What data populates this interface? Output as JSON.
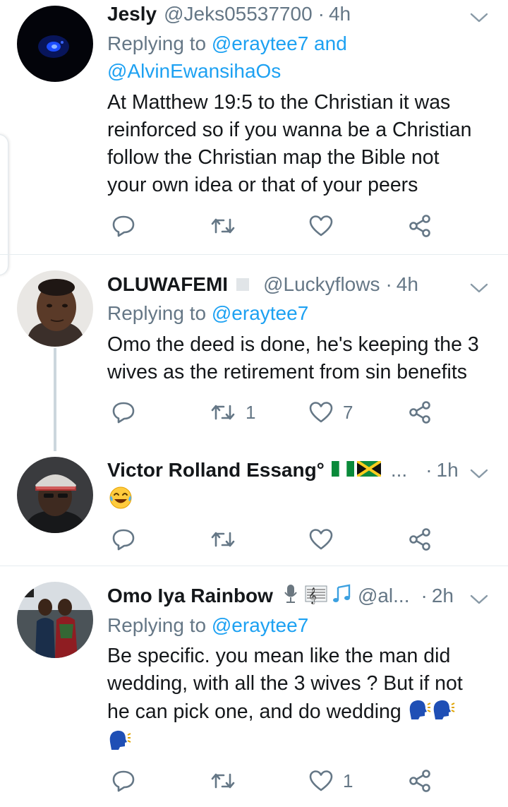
{
  "tweets": [
    {
      "name": "Jesly",
      "handle": "@Jeks05537700",
      "time": "4h",
      "replying_prefix": "Replying to",
      "replying_to": "@eraytee7 and @AlvinEwansihaOs",
      "replying_to_1": "@eraytee7 and",
      "replying_to_2": "@AlvinEwansihaOs",
      "lines": [
        "At Matthew 19:5 to the Christian it was",
        "reinforced so if you wanna be a Christian",
        "follow the Christian map the Bible not",
        "your own idea or that of your peers"
      ],
      "retweets": "",
      "likes": ""
    },
    {
      "name": "OLUWAFEMI",
      "handle": "@Luckyflows",
      "time": "4h",
      "replying_prefix": "Replying to",
      "replying_to": "@eraytee7",
      "lines": [
        "Omo the deed is done, he's keeping the 3",
        "wives as the retirement from sin benefits"
      ],
      "retweets": "1",
      "likes": "7"
    },
    {
      "name": "Victor Rolland Essang°",
      "handle_truncated": "...",
      "time": "1h",
      "emoji_body": "face-with-tears-of-joy",
      "retweets": "",
      "likes": ""
    },
    {
      "name": "Omo Iya Rainbow",
      "handle": "@al...",
      "time": "2h",
      "replying_prefix": "Replying to",
      "replying_to": "@eraytee7",
      "lines": [
        "Be specific. you mean like the man did",
        "wedding, with all the 3 wives ? But if not",
        "he can pick one, and do wedding"
      ],
      "retweets": "",
      "likes": "1"
    }
  ],
  "icons": {
    "reply": "reply-icon",
    "retweet": "retweet-icon",
    "like": "heart-icon",
    "share": "share-icon",
    "more": "chevron-down-icon"
  },
  "colors": {
    "text": "#14171a",
    "muted": "#657786",
    "link": "#1da1f2",
    "divider": "#e6ecf0"
  }
}
